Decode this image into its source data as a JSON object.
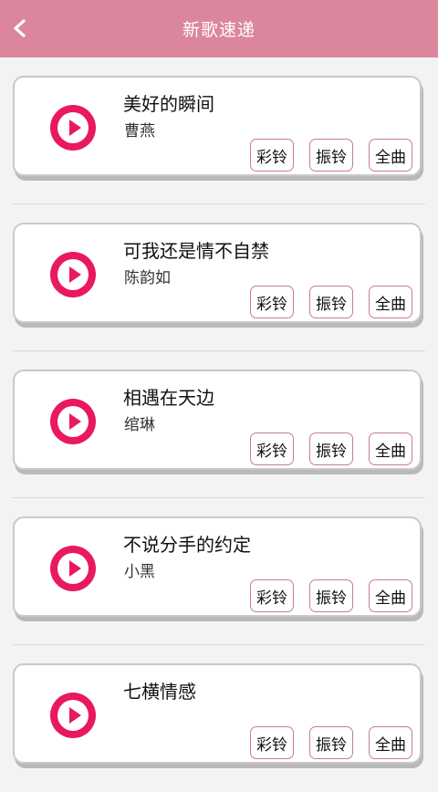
{
  "header": {
    "title": "新歌速递",
    "back_icon": "chevron-left-icon",
    "background": "#db869d"
  },
  "songs": [
    {
      "title": "美好的瞬间",
      "artist": "曹燕"
    },
    {
      "title": "可我还是情不自禁",
      "artist": "陈韵如"
    },
    {
      "title": "相遇在天边",
      "artist": "绾琳"
    },
    {
      "title": "不说分手的约定",
      "artist": "小黑"
    },
    {
      "title": "七横情感",
      "artist": ""
    }
  ],
  "actions": {
    "color_ring": "彩铃",
    "vibrate_ring": "振铃",
    "full_song": "全曲"
  },
  "accent_color": "#e8195c"
}
